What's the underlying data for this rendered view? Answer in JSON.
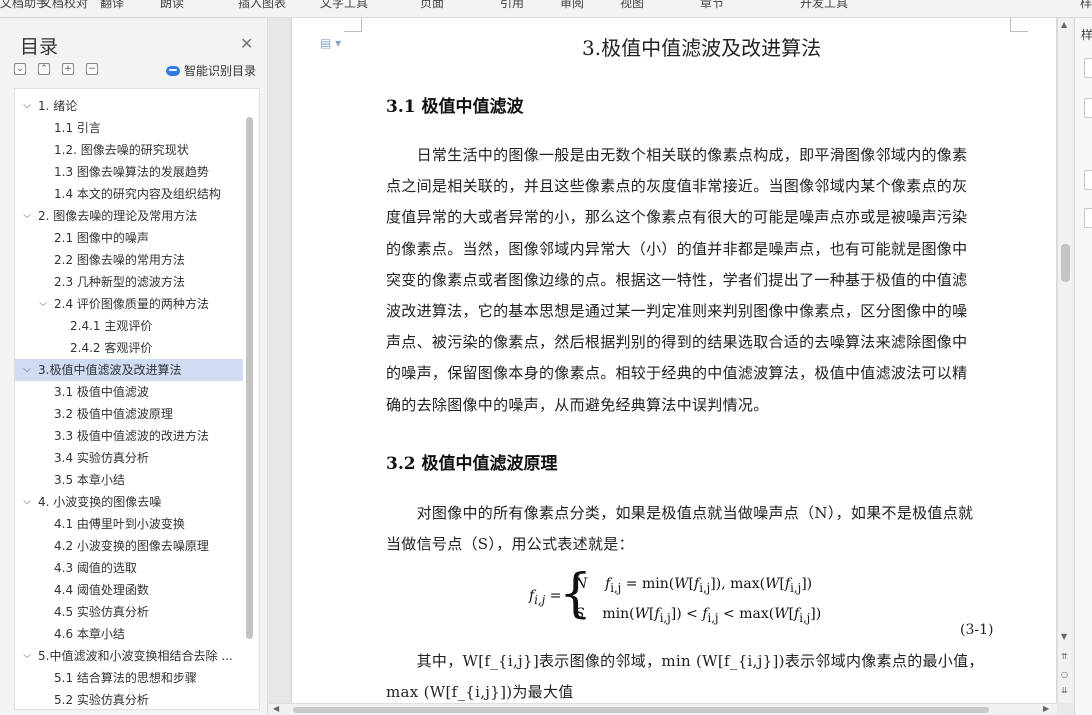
{
  "toolbar": {
    "items": [
      "文档助手",
      "文档校对",
      "翻译",
      "朗读",
      "插入图表",
      "文字工具",
      "页面",
      "引用",
      "审阅",
      "视图",
      "章节",
      "开发工具",
      "样式"
    ]
  },
  "toc": {
    "title": "目录",
    "smart_button": "智能识别目录",
    "items": [
      {
        "label": "1. 绪论",
        "level": 1,
        "chevron": "⌄"
      },
      {
        "label": "1.1 引言",
        "level": 3
      },
      {
        "label": "1.2.  图像去噪的研究现状",
        "level": 3
      },
      {
        "label": "1.3 图像去噪算法的发展趋势",
        "level": 3
      },
      {
        "label": "1.4  本文的研究内容及组织结构",
        "level": 3
      },
      {
        "label": "2.  图像去噪的理论及常用方法",
        "level": 1,
        "chevron": "⌄"
      },
      {
        "label": "2.1 图像中的噪声",
        "level": 3
      },
      {
        "label": "2.2  图像去噪的常用方法",
        "level": 3
      },
      {
        "label": "2.3 几种新型的滤波方法",
        "level": 3
      },
      {
        "label": "2.4  评价图像质量的两种方法",
        "level": 2,
        "chevron": "⌄"
      },
      {
        "label": "2.4.1 主观评价",
        "level": 4
      },
      {
        "label": "2.4.2 客观评价",
        "level": 4
      },
      {
        "label": "3.极值中值滤波及改进算法",
        "level": 1,
        "chevron": "⌄",
        "active": true
      },
      {
        "label": "3.1 极值中值滤波",
        "level": 3
      },
      {
        "label": "3.2 极值中值滤波原理",
        "level": 3
      },
      {
        "label": "3.3 极值中值滤波的改进方法",
        "level": 3
      },
      {
        "label": "3.4 实验仿真分析",
        "level": 3
      },
      {
        "label": "3.5 本章小结",
        "level": 3
      },
      {
        "label": "4.  小波变换的图像去噪",
        "level": 1,
        "chevron": "⌄"
      },
      {
        "label": "4.1 由傅里叶到小波变换",
        "level": 3
      },
      {
        "label": "4.2 小波变换的图像去噪原理",
        "level": 3
      },
      {
        "label": "4.3 阈值的选取",
        "level": 3
      },
      {
        "label": "4.4 阈值处理函数",
        "level": 3
      },
      {
        "label": "4.5  实验仿真分析",
        "level": 3
      },
      {
        "label": "4.6 本章小结",
        "level": 3
      },
      {
        "label": "5.中值滤波和小波变换相结合去除 ...",
        "level": 1,
        "chevron": "⌄"
      },
      {
        "label": "5.1 结合算法的思想和步骤",
        "level": 3
      },
      {
        "label": "5.2 实验仿真分析",
        "level": 3
      }
    ]
  },
  "doc": {
    "title": "3.极值中值滤波及改进算法",
    "h2_a": "3.1 极值中值滤波",
    "para1": [
      "　　日常生活中的图像一般是由无数个相关联的像素点构成，即平滑图像邻域内的像素",
      "点之间是相关联的，并且这些像素点的灰度值非常接近。当图像邻域内某个像素点的灰",
      "度值异常的大或者异常的小，那么这个像素点有很大的可能是噪声点亦或是被噪声污染",
      "的像素点。当然，图像邻域内异常大（小）的值并非都是噪声点，也有可能就是图像中",
      "突变的像素点或者图像边缘的点。根据这一特性，学者们提出了一种基于极值的中值滤",
      "波改进算法，它的基本思想是通过某一判定准则来判别图像中像素点，区分图像中的噪",
      "声点、被污染的像素点，然后根据判别的得到的结果选取合适的去噪算法来滤除图像中",
      "的噪声，保留图像本身的像素点。相较于经典的中值滤波算法，极值中值滤波法可以精",
      "确的去除图像中的噪声，从而避免经典算法中误判情况。"
    ],
    "h2_b": "3.2 极值中值滤波原理",
    "para2": [
      "　　对图像中的所有像素点分类，如果是极值点就当做噪声点（N），如果不是极值点就",
      "当做信号点（S），用公式表述就是："
    ],
    "formula": {
      "lhs": "f_{i,j} =",
      "row1": "N     f_{i,j} = min(W[f_{i,j}]), max(W[f_{i,j}])",
      "row2": "S     min(W[f_{i,j}]) < f_{i,j} < max(W[f_{i,j}])"
    },
    "eq_number": "(3-1)",
    "para3": [
      "　　其中，W[f_{i,j}]表示图像的邻域，min (W[f_{i,j}])表示邻域内像素点的最小值，",
      "max (W[f_{i,j}])为最大值"
    ]
  },
  "right_pane": {
    "label": "样"
  }
}
